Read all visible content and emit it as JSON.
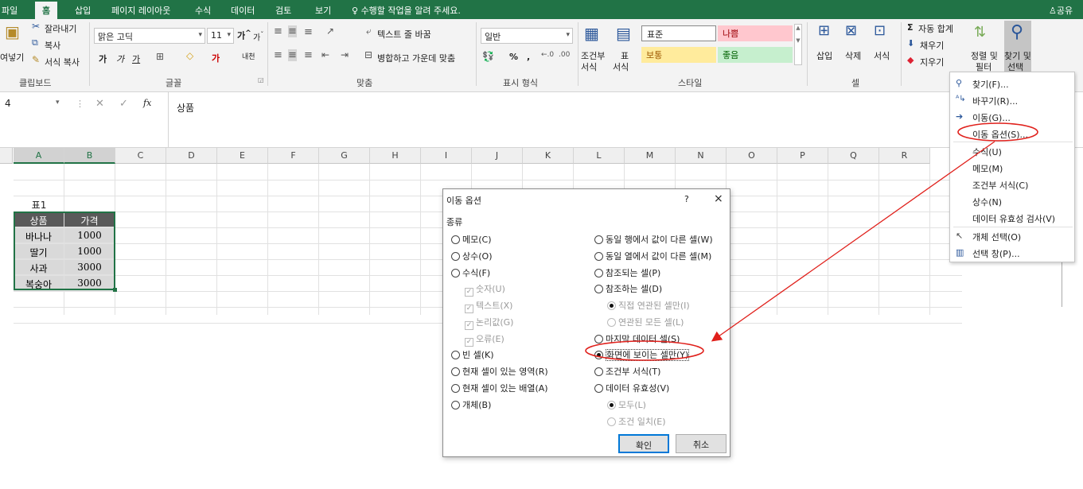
{
  "tabs": {
    "file": "파일",
    "home": "홈",
    "insert": "삽입",
    "page_layout": "페이지 레이아웃",
    "formulas": "수식",
    "data": "데이터",
    "review": "검토",
    "view": "보기",
    "tell_me": "수행할 작업을 알려 주세요.",
    "share": "공유"
  },
  "ribbon": {
    "clipboard": {
      "cut": "잘라내기",
      "copy": "복사",
      "paste": "여넣기",
      "format_painter": "서식 복사",
      "label": "클립보드"
    },
    "font": {
      "name": "맑은 고딕",
      "size": "11",
      "bold": "가",
      "italic": "가",
      "underline": "가",
      "phonetic": "내천",
      "label": "글꼴"
    },
    "alignment": {
      "wrap_text": "텍스트 줄 바꿈",
      "merge_center": "병합하고 가운데 맞춤",
      "label": "맞춤"
    },
    "number": {
      "format": "일반",
      "percent": "%",
      "comma": ",",
      "label": "표시 형식"
    },
    "styles": {
      "conditional": "조건부",
      "conditional2": "서식",
      "table": "표",
      "table2": "서식",
      "normal": "표준",
      "bad": "나쁨",
      "neutral": "보통",
      "good": "좋음",
      "label": "스타일"
    },
    "cells": {
      "insert": "삽입",
      "delete": "삭제",
      "format": "서식",
      "label": "셀"
    },
    "editing": {
      "autosum": "자동 합계",
      "fill": "채우기",
      "clear": "지우기",
      "sort_filter": "정렬 및",
      "sort_filter2": "필터",
      "find_select": "찾기 및",
      "find_select2": "선택"
    }
  },
  "formula_bar": {
    "name_box": "4",
    "fx": "fx",
    "content": "상품"
  },
  "columns": [
    "A",
    "B",
    "C",
    "D",
    "E",
    "F",
    "G",
    "H",
    "I",
    "J",
    "K",
    "L",
    "M",
    "N",
    "O",
    "P",
    "Q",
    "R"
  ],
  "sheet": {
    "table_title": "표1",
    "headers": [
      "상품",
      "가격"
    ],
    "rows": [
      [
        "바나나",
        "1000"
      ],
      [
        "딸기",
        "1000"
      ],
      [
        "사과",
        "3000"
      ],
      [
        "복숭아",
        "3000"
      ]
    ]
  },
  "dialog": {
    "title": "이동 옵션",
    "help": "?",
    "close": "×",
    "group": "종류",
    "left_options": {
      "comments": "메모(C)",
      "constants": "상수(O)",
      "formulas": "수식(F)",
      "numbers": "숫자(U)",
      "text": "텍스트(X)",
      "logicals": "논리값(G)",
      "errors": "오류(E)",
      "blanks": "빈 셀(K)",
      "current_region": "현재 셀이 있는 영역(R)",
      "current_array": "현재 셀이 있는 배열(A)",
      "objects": "개체(B)"
    },
    "right_options": {
      "row_diff": "동일 행에서 값이 다른 셀(W)",
      "col_diff": "동일 열에서 값이 다른 셀(M)",
      "precedents": "참조되는 셀(P)",
      "dependents": "참조하는 셀(D)",
      "direct_only": "직접 연관된 셀만(I)",
      "all_levels": "연관된 모든 셀(L)",
      "last_cell": "마지막 데이터 셀(S)",
      "visible_only": "화면에 보이는 셀만(Y)",
      "conditional": "조건부 서식(T)",
      "validation": "데이터 유효성(V)",
      "all": "모두(L)",
      "same": "조건 일치(E)"
    },
    "ok": "확인",
    "cancel": "취소"
  },
  "find_menu": {
    "find": "찾기(F)...",
    "replace": "바꾸기(R)...",
    "goto": "이동(G)...",
    "goto_special": "이동 옵션(S)...",
    "formulas": "수식(U)",
    "comments": "메모(M)",
    "conditional": "조건부 서식(C)",
    "constants": "상수(N)",
    "validation": "데이터 유효성 검사(V)",
    "select_objects": "개체 선택(O)",
    "selection_pane": "선택 창(P)..."
  },
  "colors": {
    "excel_green": "#217346",
    "header_fill": "#595959",
    "data_fill": "#d9d9d9",
    "annotation_red": "#e0201b",
    "bad_fill": "#ffc7ce",
    "neutral_fill": "#ffeb9c",
    "good_fill": "#c6efce"
  }
}
